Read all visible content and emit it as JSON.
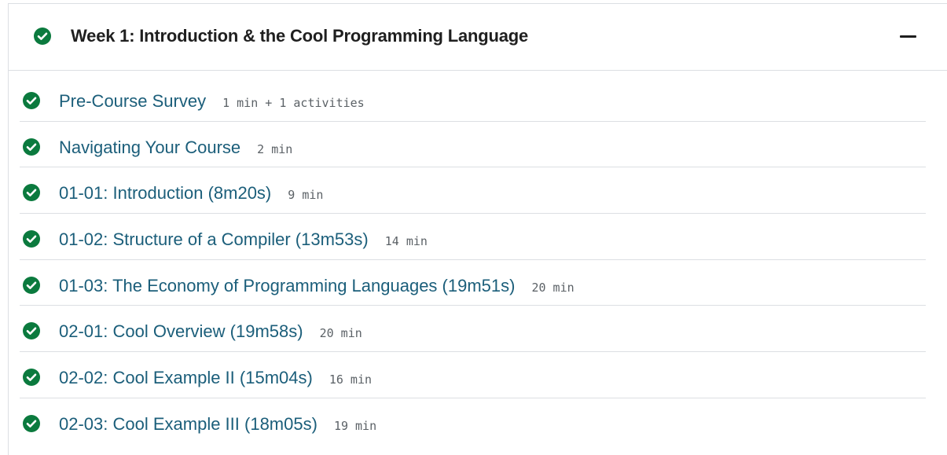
{
  "colors": {
    "check_green": "#0b7a3e",
    "title_text": "#1f1f1f",
    "link_text": "#1b5e7a",
    "meta_text": "#5b6166",
    "divider": "#dcdfe3"
  },
  "section": {
    "title": "Week 1: Introduction & the Cool Programming Language",
    "status_icon": "check-circle-icon",
    "collapse_icon": "minus-icon"
  },
  "items": [
    {
      "label": "Pre-Course Survey",
      "meta": "1 min + 1 activities",
      "status_icon": "check-circle-icon"
    },
    {
      "label": "Navigating Your Course",
      "meta": "2 min",
      "status_icon": "check-circle-icon"
    },
    {
      "label": "01-01: Introduction (8m20s)",
      "meta": "9 min",
      "status_icon": "check-circle-icon"
    },
    {
      "label": "01-02: Structure of a Compiler (13m53s)",
      "meta": "14 min",
      "status_icon": "check-circle-icon"
    },
    {
      "label": "01-03: The Economy of Programming Languages (19m51s)",
      "meta": "20 min",
      "status_icon": "check-circle-icon"
    },
    {
      "label": "02-01: Cool Overview (19m58s)",
      "meta": "20 min",
      "status_icon": "check-circle-icon"
    },
    {
      "label": "02-02: Cool Example II (15m04s)",
      "meta": "16 min",
      "status_icon": "check-circle-icon"
    },
    {
      "label": "02-03: Cool Example III (18m05s)",
      "meta": "19 min",
      "status_icon": "check-circle-icon"
    }
  ]
}
